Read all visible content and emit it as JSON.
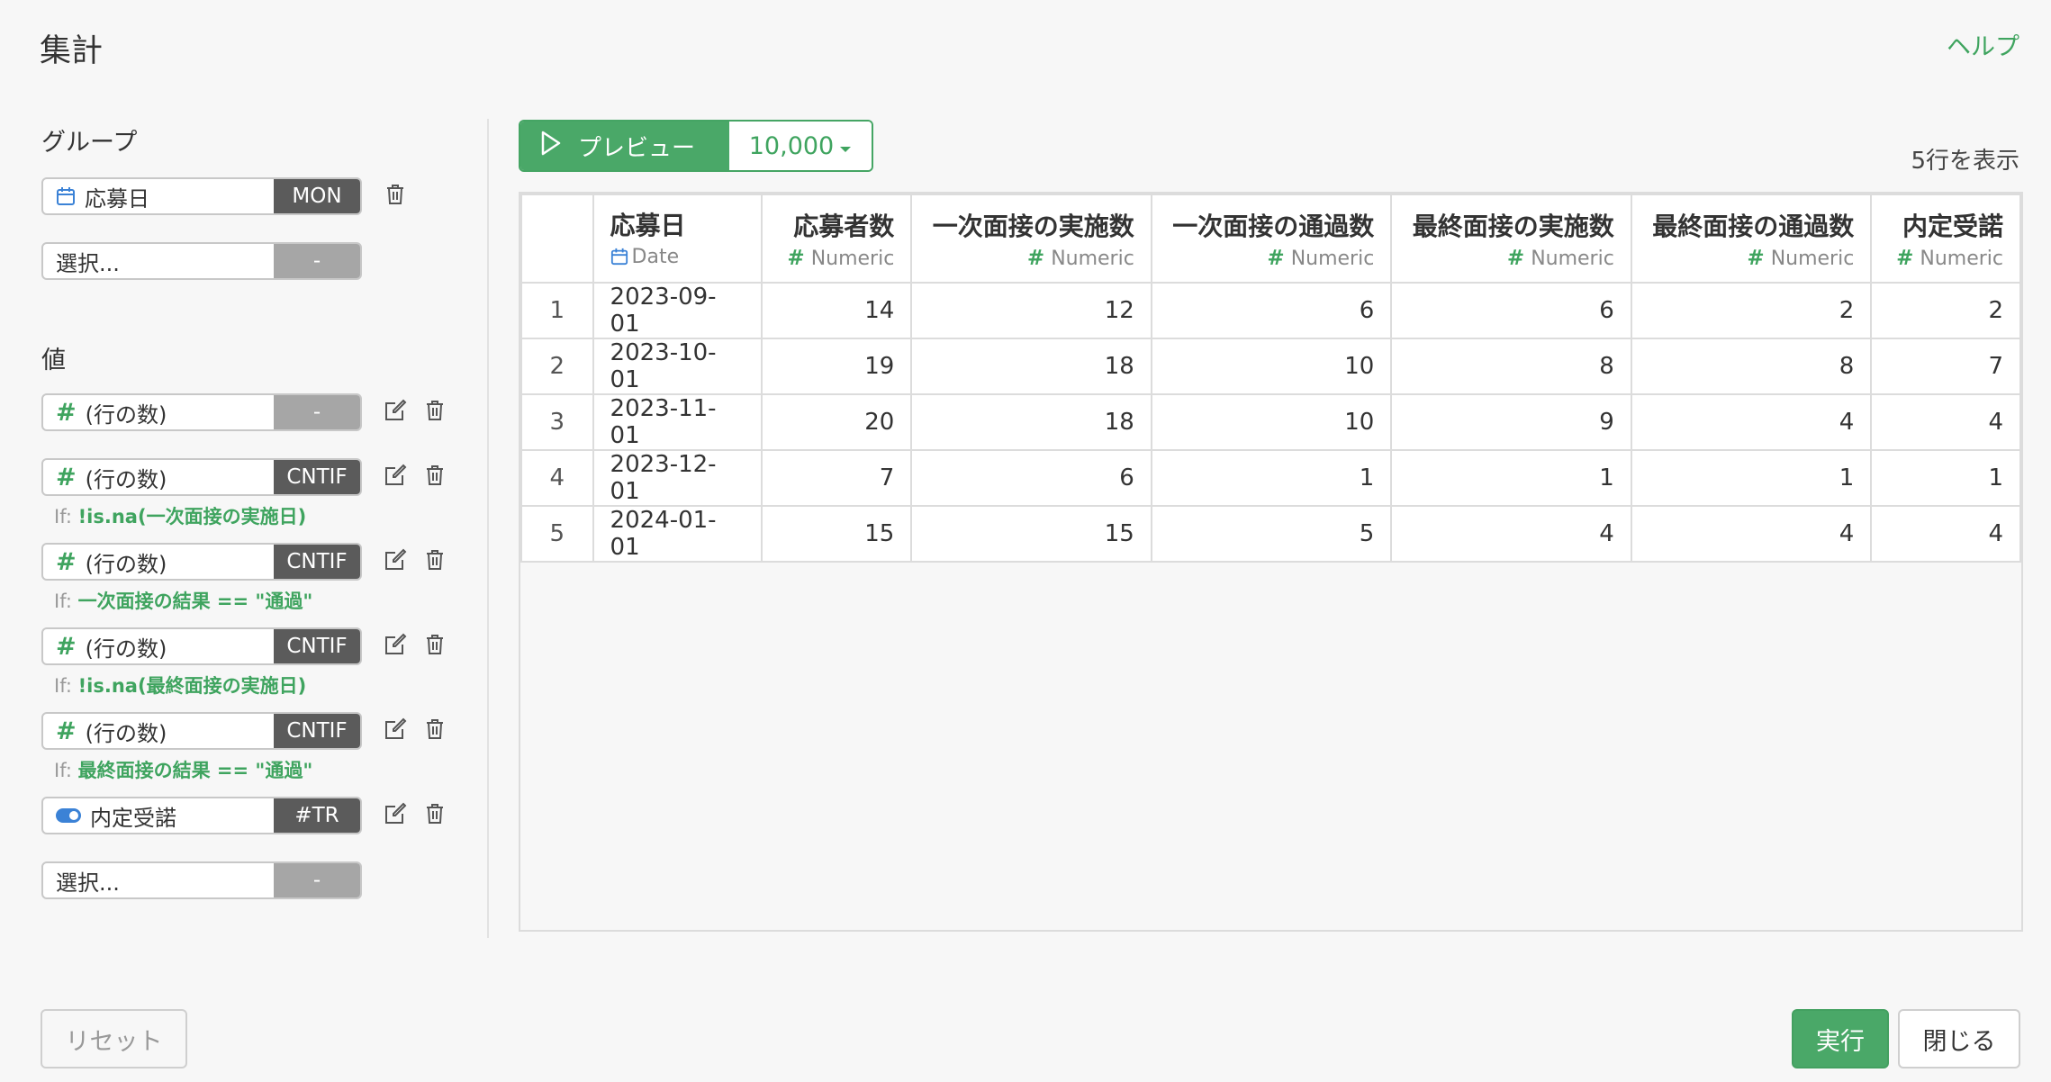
{
  "header": {
    "title": "集計",
    "help_link": "ヘルプ"
  },
  "group_section": {
    "label": "グループ",
    "fields": [
      {
        "name": "応募日",
        "func": "MON",
        "icon": "calendar-icon"
      }
    ],
    "placeholder": {
      "name": "選択...",
      "func": "-"
    }
  },
  "value_section": {
    "label": "値",
    "fields": [
      {
        "name": "(行の数)",
        "func": "-",
        "icon": "hash-icon"
      },
      {
        "name": "(行の数)",
        "func": "CNTIF",
        "icon": "hash-icon",
        "cond_prefix": "If:",
        "cond": "!is.na(一次面接の実施日)"
      },
      {
        "name": "(行の数)",
        "func": "CNTIF",
        "icon": "hash-icon",
        "cond_prefix": "If:",
        "cond": "一次面接の結果 == \"通過\""
      },
      {
        "name": "(行の数)",
        "func": "CNTIF",
        "icon": "hash-icon",
        "cond_prefix": "If:",
        "cond": "!is.na(最終面接の実施日)"
      },
      {
        "name": "(行の数)",
        "func": "CNTIF",
        "icon": "hash-icon",
        "cond_prefix": "If:",
        "cond": "最終面接の結果 == \"通過\""
      },
      {
        "name": "内定受諾",
        "func": "#TR",
        "icon": "toggle-icon"
      }
    ],
    "placeholder": {
      "name": "選択...",
      "func": "-"
    }
  },
  "preview": {
    "button_label": "プレビュー",
    "row_limit": "10,000",
    "row_count_text": "5行を表示"
  },
  "table": {
    "columns": [
      {
        "name": "応募日",
        "type": "Date",
        "type_icon": "calendar-icon"
      },
      {
        "name": "応募者数",
        "type": "Numeric",
        "type_icon": "hash-icon"
      },
      {
        "name": "一次面接の実施数",
        "type": "Numeric",
        "type_icon": "hash-icon"
      },
      {
        "name": "一次面接の通過数",
        "type": "Numeric",
        "type_icon": "hash-icon"
      },
      {
        "name": "最終面接の実施数",
        "type": "Numeric",
        "type_icon": "hash-icon"
      },
      {
        "name": "最終面接の通過数",
        "type": "Numeric",
        "type_icon": "hash-icon"
      },
      {
        "name": "内定受諾",
        "type": "Numeric",
        "type_icon": "hash-icon"
      }
    ],
    "rows": [
      [
        "1",
        "2023-09-01",
        "14",
        "12",
        "6",
        "6",
        "2",
        "2"
      ],
      [
        "2",
        "2023-10-01",
        "19",
        "18",
        "10",
        "8",
        "8",
        "7"
      ],
      [
        "3",
        "2023-11-01",
        "20",
        "18",
        "10",
        "9",
        "4",
        "4"
      ],
      [
        "4",
        "2023-12-01",
        "7",
        "6",
        "1",
        "1",
        "1",
        "1"
      ],
      [
        "5",
        "2024-01-01",
        "15",
        "15",
        "5",
        "4",
        "4",
        "4"
      ]
    ]
  },
  "footer": {
    "reset_label": "リセット",
    "run_label": "実行",
    "close_label": "閉じる"
  },
  "colors": {
    "accent": "#4aa868",
    "function_badge": "#5b5b5b",
    "function_badge_empty": "#a6a6a6",
    "toggle": "#3b82d6"
  }
}
